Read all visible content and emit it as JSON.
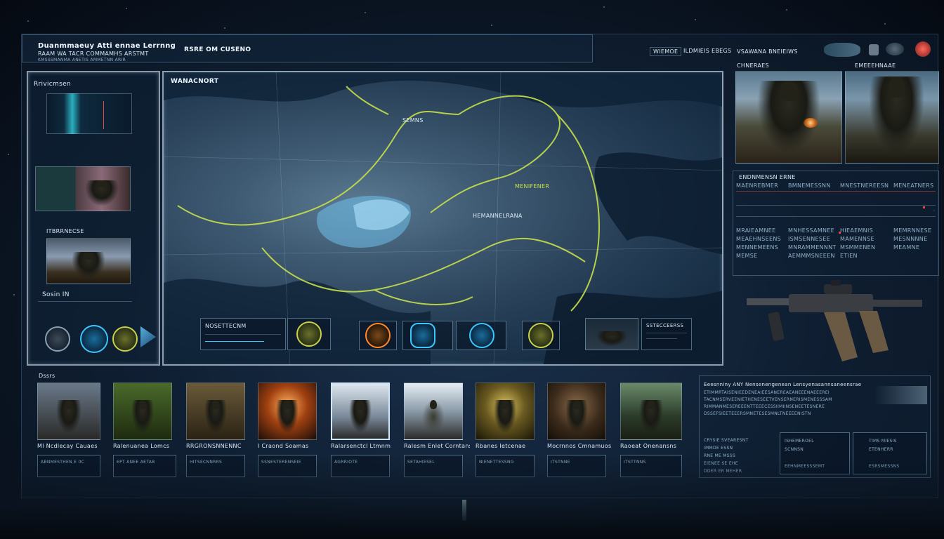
{
  "header": {
    "title_line1": "Duanmmaeuy Atti ennae Lerrnng",
    "title_line2": "RAAM WA TACR COMMAMHS ARSTMT",
    "subtitle": "KMSSSMANMA ANETIS AMMETNN ARIR",
    "status": "RSRE OM CUSENO",
    "right_label_a": "WIEMOE",
    "right_label_b": "ILDMIEIS EBEGS"
  },
  "left_panel": {
    "top_label": "Rrivicmsen",
    "mid_label": "ITBRRNECSE",
    "bottom_label": "Sosin IN"
  },
  "map": {
    "title": "WANACNORT",
    "route_label": "SEMNS",
    "center_label": "HEMANNELRANA",
    "region_label": "MENIFENER"
  },
  "map_toolbar": {
    "items": [
      {
        "label": "NOSETTECNM"
      },
      {
        "label": "SSTECCEERSS"
      }
    ]
  },
  "right_panel": {
    "title": "VSAWANA BNEIEIWS",
    "cam_label_a": "CHNERAES",
    "cam_label_b": "EMEEEHNAAE",
    "stats_title": "ENDNMENSN ERNE",
    "stats_rows": [
      {
        "a": "MAENREBMER",
        "b": "BMNEMESSNN",
        "c": "MNESTNEREESN",
        "d": "MENEATNERS"
      },
      {
        "a": "MRAIEAMNEE",
        "b": "MNHESSAMNEE",
        "c": "HIEAEMNIS",
        "d": "MEMRNNESE"
      },
      {
        "a": "MEAEHNSEENS",
        "b": "ISMSENNESEE",
        "c": "MAMENNSE",
        "d": "MESNNNNE"
      },
      {
        "a": "MENNEMEENS",
        "b": "MNRAMMENNNT",
        "c": "MSMMENEN",
        "d": "MEAMNE"
      },
      {
        "a": "MEMSE",
        "b": "AEMMMSNEEEN",
        "c": "ETIEN",
        "d": ""
      }
    ]
  },
  "roster": {
    "label": "Dssrs",
    "cards": [
      {
        "name": "Ml Ncdlecay Cauaes",
        "sub": "ABNMESTHEN E 0C"
      },
      {
        "name": "Ralenuanea Lomcs",
        "sub": "EPT ANEE AETAB"
      },
      {
        "name": "RRGRONSNNENNC",
        "sub": "HITSECNNRRS"
      },
      {
        "name": "I Craond Soamas",
        "sub": "SSNESTERENSEIE"
      },
      {
        "name": "Ralarsenctcl Ltmnm",
        "sub": "AGRRIOTE"
      },
      {
        "name": "Ralesm Enlet Corntans",
        "sub": "SETAHIESEL"
      },
      {
        "name": "Rbanes Ietcenae",
        "sub": "NIENETTESSNG"
      },
      {
        "name": "Mocrnnos Cmnamuos",
        "sub": "ITSTNNE"
      },
      {
        "name": "Raoeat Onenansns",
        "sub": "ITSTTNNS"
      }
    ]
  },
  "info_panel": {
    "lines": [
      "Eeesnniny ANY Nensenengenean Lensyenasannsaneensrae",
      "ETIMMRTAISENIEEDENEAIEESANEREAEANEEENAEEEREI",
      "TACNMSERVEENIETHENESEETVENSERNERISMENESSSAM",
      "RIMMANMESEREEENTTEEECESSIIMIINSENEETESNERE",
      "DSSEFSIEETEEERSMNETESESMNLTNEEEENISTN"
    ],
    "block_a": [
      "CRYSIE SVEARESNT",
      "IMMDE ESSN",
      "RNE ME MSSS",
      "EIENEE SE EHE",
      "DDER ER MEHER"
    ],
    "block_b": [
      "ISHEMEROEL",
      "SCNNSN",
      "EEHNMEESSSEMT"
    ],
    "block_c": [
      "TIMS MIESIS",
      "ETENHERR",
      "ESRSMESSNS"
    ]
  },
  "colors": {
    "route": "#c7e04a",
    "accent": "#3cc6ff",
    "alert": "#e64a3a"
  }
}
